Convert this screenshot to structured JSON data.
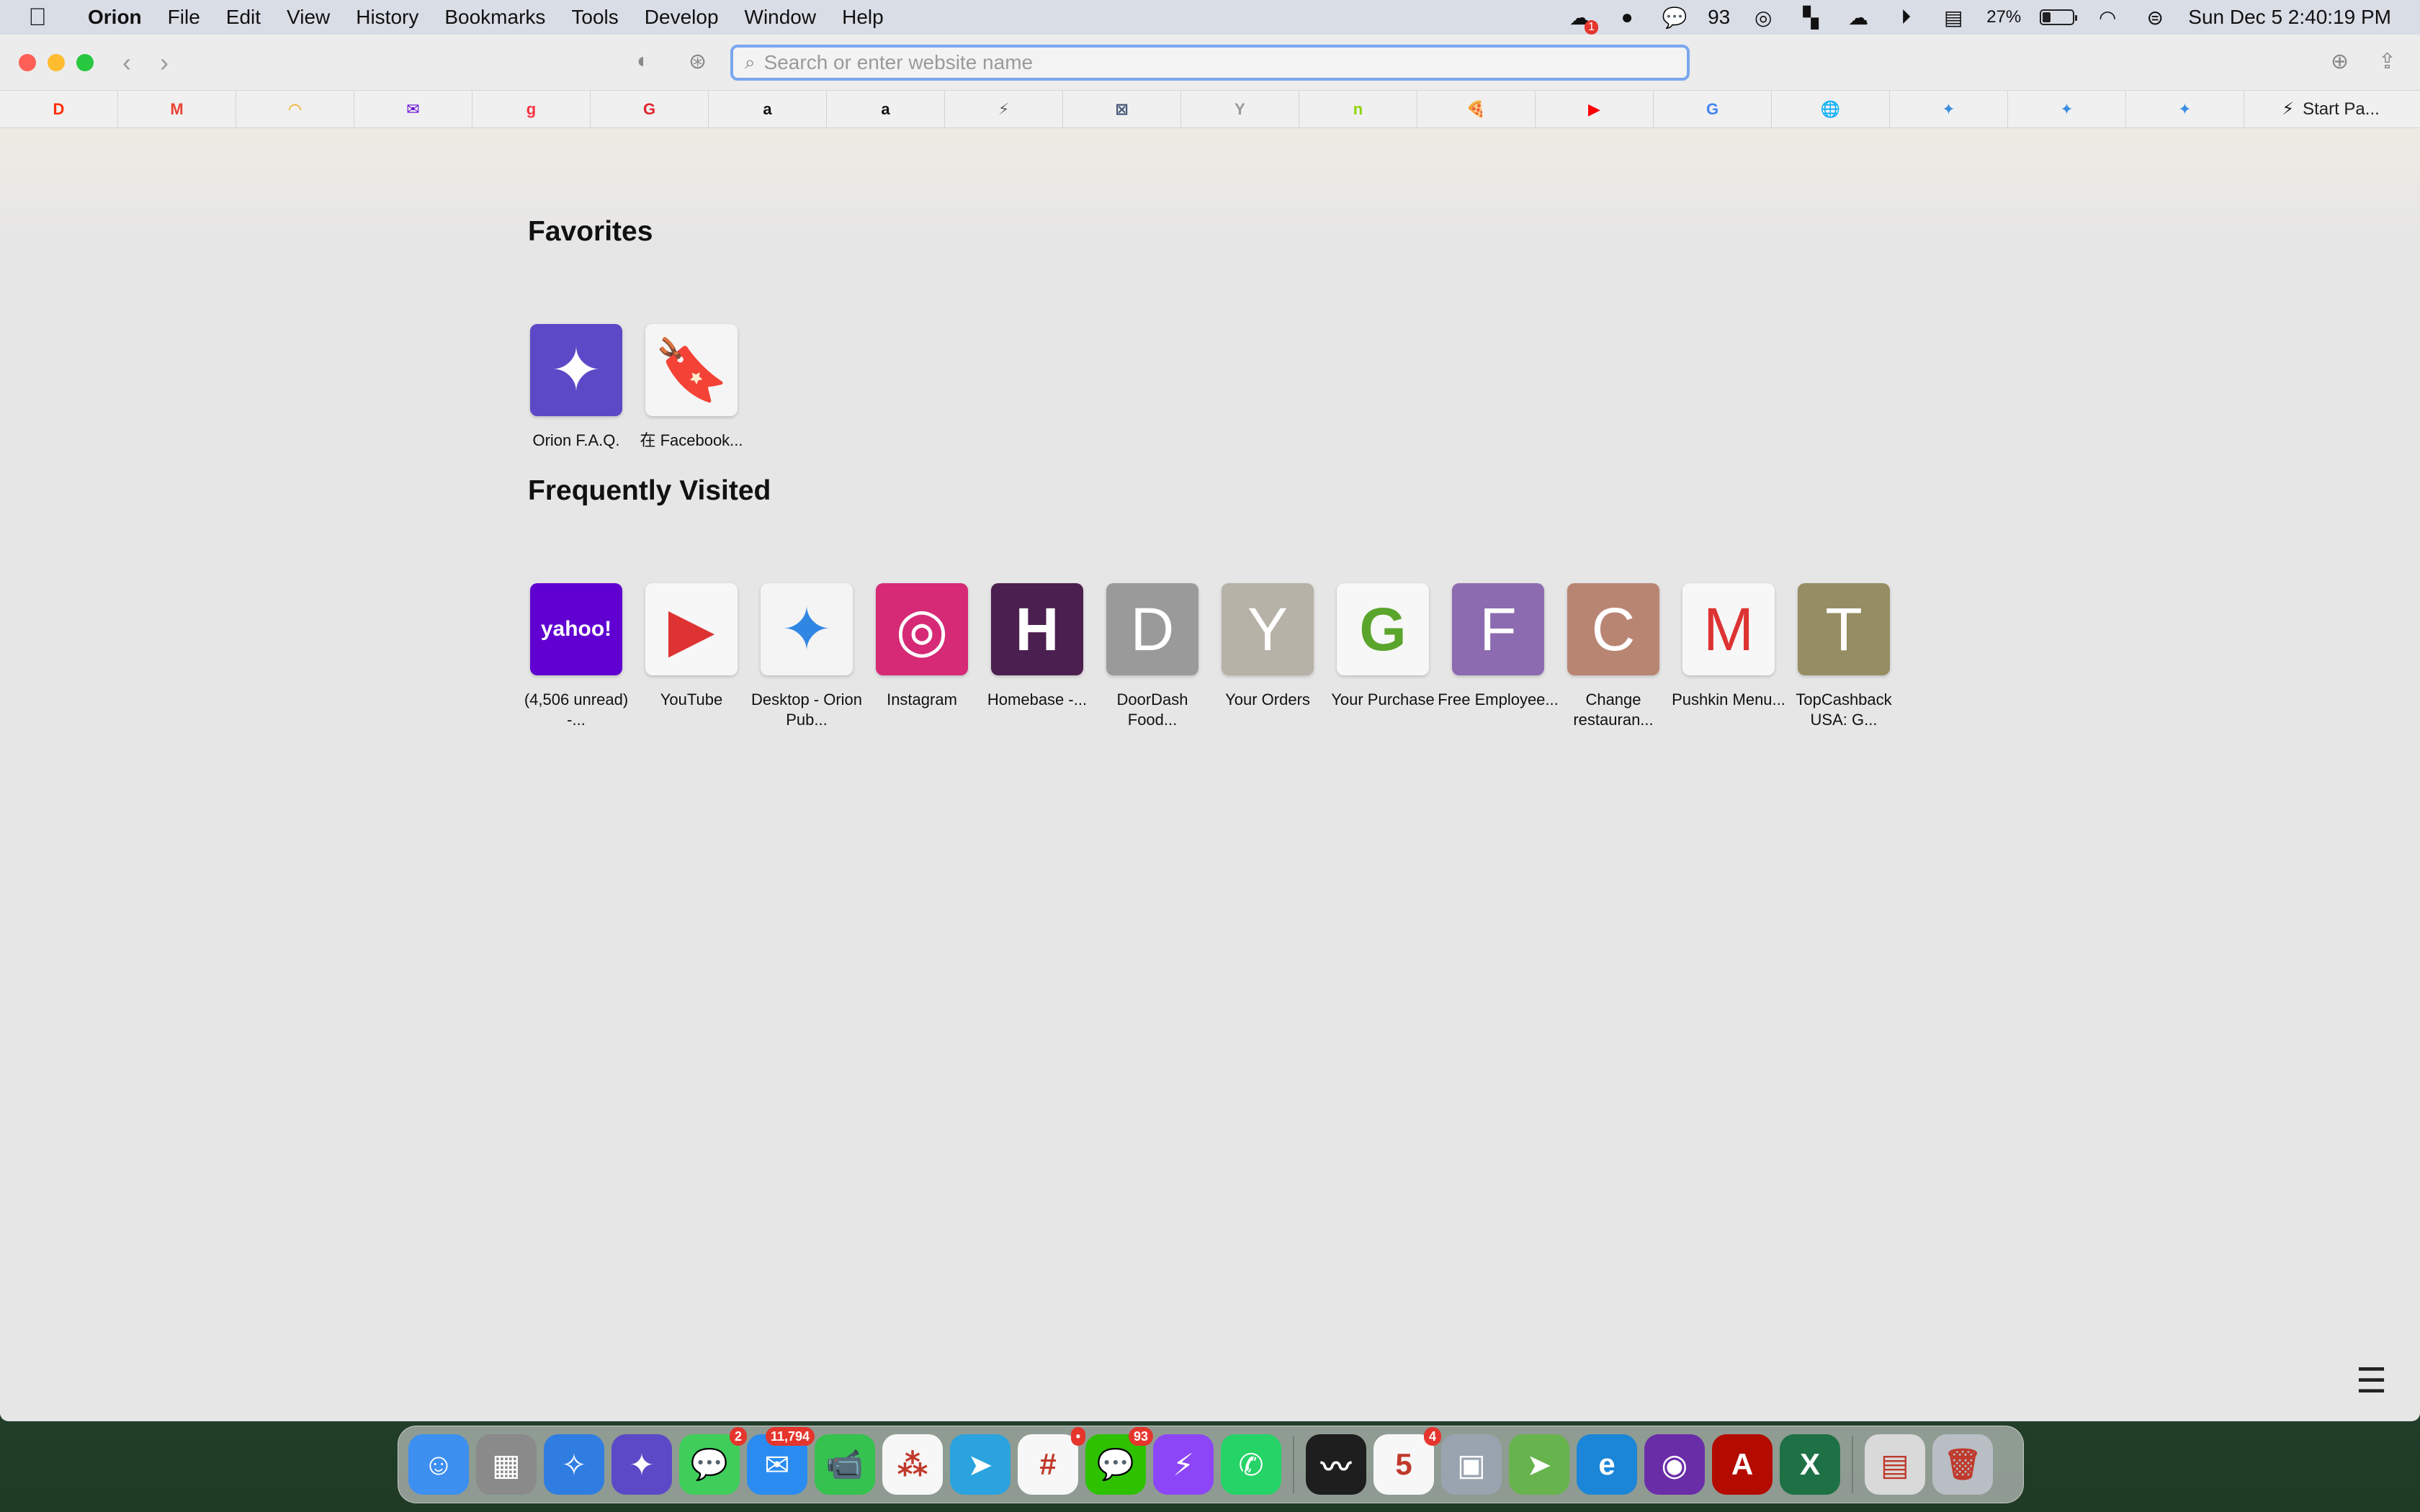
{
  "menubar": {
    "apple_icon": "apple-logo-icon",
    "items": [
      "Orion",
      "File",
      "Edit",
      "View",
      "History",
      "Bookmarks",
      "Tools",
      "Develop",
      "Window",
      "Help"
    ],
    "status": {
      "cloud_badge": "1",
      "wechat_count": "93",
      "battery_percent": "27%",
      "battery_level": 0.27,
      "datetime": "Sun Dec 5  2:40:19 PM"
    }
  },
  "toolbar": {
    "url_placeholder": "Search or enter website name"
  },
  "bookmarks_bar": {
    "items": [
      {
        "icon": "doordash-icon",
        "glyph": "D",
        "color": "#ff3008"
      },
      {
        "icon": "gmail-icon",
        "glyph": "M",
        "color": "#ea4335"
      },
      {
        "icon": "rainbow-icon",
        "glyph": "◠",
        "color": "#f4a300"
      },
      {
        "icon": "yahoo-mail-icon",
        "glyph": "✉",
        "color": "#6001d2"
      },
      {
        "icon": "grubhub-icon",
        "glyph": "g",
        "color": "#f63440"
      },
      {
        "icon": "groupon-icon",
        "glyph": "G",
        "color": "#e0262f"
      },
      {
        "icon": "amazon-icon",
        "glyph": "a",
        "color": "#111111"
      },
      {
        "icon": "amazon-icon",
        "glyph": "a",
        "color": "#111111"
      },
      {
        "icon": "bolt-icon",
        "glyph": "⚡",
        "color": "#666666"
      },
      {
        "icon": "grid-icon",
        "glyph": "⊠",
        "color": "#445577"
      },
      {
        "icon": "y-icon",
        "glyph": "Y",
        "color": "#9a9a9a"
      },
      {
        "icon": "nextdoor-icon",
        "glyph": "n",
        "color": "#8ed500"
      },
      {
        "icon": "pizza-icon",
        "glyph": "🍕",
        "color": "#e46b1c"
      },
      {
        "icon": "youtube-icon",
        "glyph": "▶",
        "color": "#ff0000"
      },
      {
        "icon": "google-icon",
        "glyph": "G",
        "color": "#4285f4"
      },
      {
        "icon": "globe-icon",
        "glyph": "🌐",
        "color": "#2d55c8"
      },
      {
        "icon": "orion-icon",
        "glyph": "✦",
        "color": "#3b8ee0"
      },
      {
        "icon": "orion-icon",
        "glyph": "✦",
        "color": "#3b8ee0"
      },
      {
        "icon": "orion-icon",
        "glyph": "✦",
        "color": "#3b8ee0"
      }
    ],
    "start_page_label": "Start Pa..."
  },
  "favorites": {
    "title": "Favorites",
    "items": [
      {
        "label": "Orion F.A.Q.",
        "icon": "orion-star-icon",
        "glyph": "✦",
        "bg": "#5c49c7"
      },
      {
        "label": "在 Facebook...",
        "icon": "bookmark-icon",
        "glyph": "🔖",
        "bg": "#f5f5f5"
      }
    ]
  },
  "frequently_visited": {
    "title": "Frequently Visited",
    "items": [
      {
        "label": "(4,506 unread) -...",
        "icon": "yahoo-mail-icon",
        "glyph": "yahoo!",
        "bg": "#6001d2"
      },
      {
        "label": "YouTube",
        "icon": "youtube-icon",
        "glyph": "▶",
        "bg": "#f7f7f7"
      },
      {
        "label": "Desktop - Orion Pub...",
        "icon": "orion-star-icon",
        "glyph": "✦",
        "bg": "#f4f4f4"
      },
      {
        "label": "Instagram",
        "icon": "instagram-icon",
        "glyph": "◎",
        "bg": "#d62976"
      },
      {
        "label": "Homebase -...",
        "icon": "homebase-icon",
        "glyph": "H",
        "bg": "#4b1f4f"
      },
      {
        "label": "DoorDash Food...",
        "icon": "letter-d-icon",
        "glyph": "D",
        "bg": "#9a9a9a"
      },
      {
        "label": "Your Orders",
        "icon": "letter-y-icon",
        "glyph": "Y",
        "bg": "#b7b2a8"
      },
      {
        "label": "Your Purchase",
        "icon": "grubhub-g-icon",
        "glyph": "G",
        "bg": "#f7f7f7"
      },
      {
        "label": "Free Employee...",
        "icon": "letter-f-icon",
        "glyph": "F",
        "bg": "#8d6bb0"
      },
      {
        "label": "Change restauran...",
        "icon": "letter-c-icon",
        "glyph": "C",
        "bg": "#b98573"
      },
      {
        "label": "Pushkin Menu...",
        "icon": "gmail-icon",
        "glyph": "M",
        "bg": "#f7f7f7"
      },
      {
        "label": "TopCashback USA: G...",
        "icon": "letter-t-icon",
        "glyph": "T",
        "bg": "#968d62"
      }
    ]
  },
  "dock": {
    "apps": [
      {
        "icon": "finder-icon",
        "glyph": "☺",
        "bg": "#3d8ff0"
      },
      {
        "icon": "launchpad-icon",
        "glyph": "▦",
        "bg": "#8a8a8a"
      },
      {
        "icon": "safari-icon",
        "glyph": "✧",
        "bg": "#2f7de1"
      },
      {
        "icon": "orion-icon",
        "glyph": "✦",
        "bg": "#5c49c7"
      },
      {
        "icon": "messages-icon",
        "glyph": "💬",
        "bg": "#3fce5a",
        "badge": "2"
      },
      {
        "icon": "mail-icon",
        "glyph": "✉",
        "bg": "#2a8cf0",
        "badge": "11,794"
      },
      {
        "icon": "facetime-icon",
        "glyph": "📹",
        "bg": "#35c24f"
      },
      {
        "icon": "asana-icon",
        "glyph": "⁂",
        "bg": "#f7f7f7"
      },
      {
        "icon": "telegram-icon",
        "glyph": "➤",
        "bg": "#2aa3df"
      },
      {
        "icon": "slack-icon",
        "glyph": "#",
        "bg": "#f7f7f7",
        "badge": "•"
      },
      {
        "icon": "wechat-icon",
        "glyph": "💬",
        "bg": "#2dc100",
        "badge": "93"
      },
      {
        "icon": "messenger-icon",
        "glyph": "⚡",
        "bg": "#8c46f7"
      },
      {
        "icon": "whatsapp-icon",
        "glyph": "✆",
        "bg": "#25d366"
      },
      {
        "icon": "activity-monitor-icon",
        "glyph": "〰",
        "bg": "#1e1e1e"
      },
      {
        "icon": "calendar-icon",
        "glyph": "5",
        "bg": "#f7f7f7",
        "badge": "4"
      },
      {
        "icon": "preview-icon",
        "glyph": "▣",
        "bg": "#9aa4b0"
      },
      {
        "icon": "maps-icon",
        "glyph": "➤",
        "bg": "#67b34d"
      },
      {
        "icon": "edge-icon",
        "glyph": "e",
        "bg": "#1b85d8"
      },
      {
        "icon": "vpn-icon",
        "glyph": "◉",
        "bg": "#6a2da8"
      },
      {
        "icon": "acrobat-icon",
        "glyph": "A",
        "bg": "#b30b00"
      },
      {
        "icon": "excel-icon",
        "glyph": "X",
        "bg": "#1e7145"
      },
      {
        "icon": "csv-file-icon",
        "glyph": "▤",
        "bg": "#d9d9d9"
      },
      {
        "icon": "trash-icon",
        "glyph": "🗑",
        "bg": "#b8bec4"
      }
    ]
  }
}
